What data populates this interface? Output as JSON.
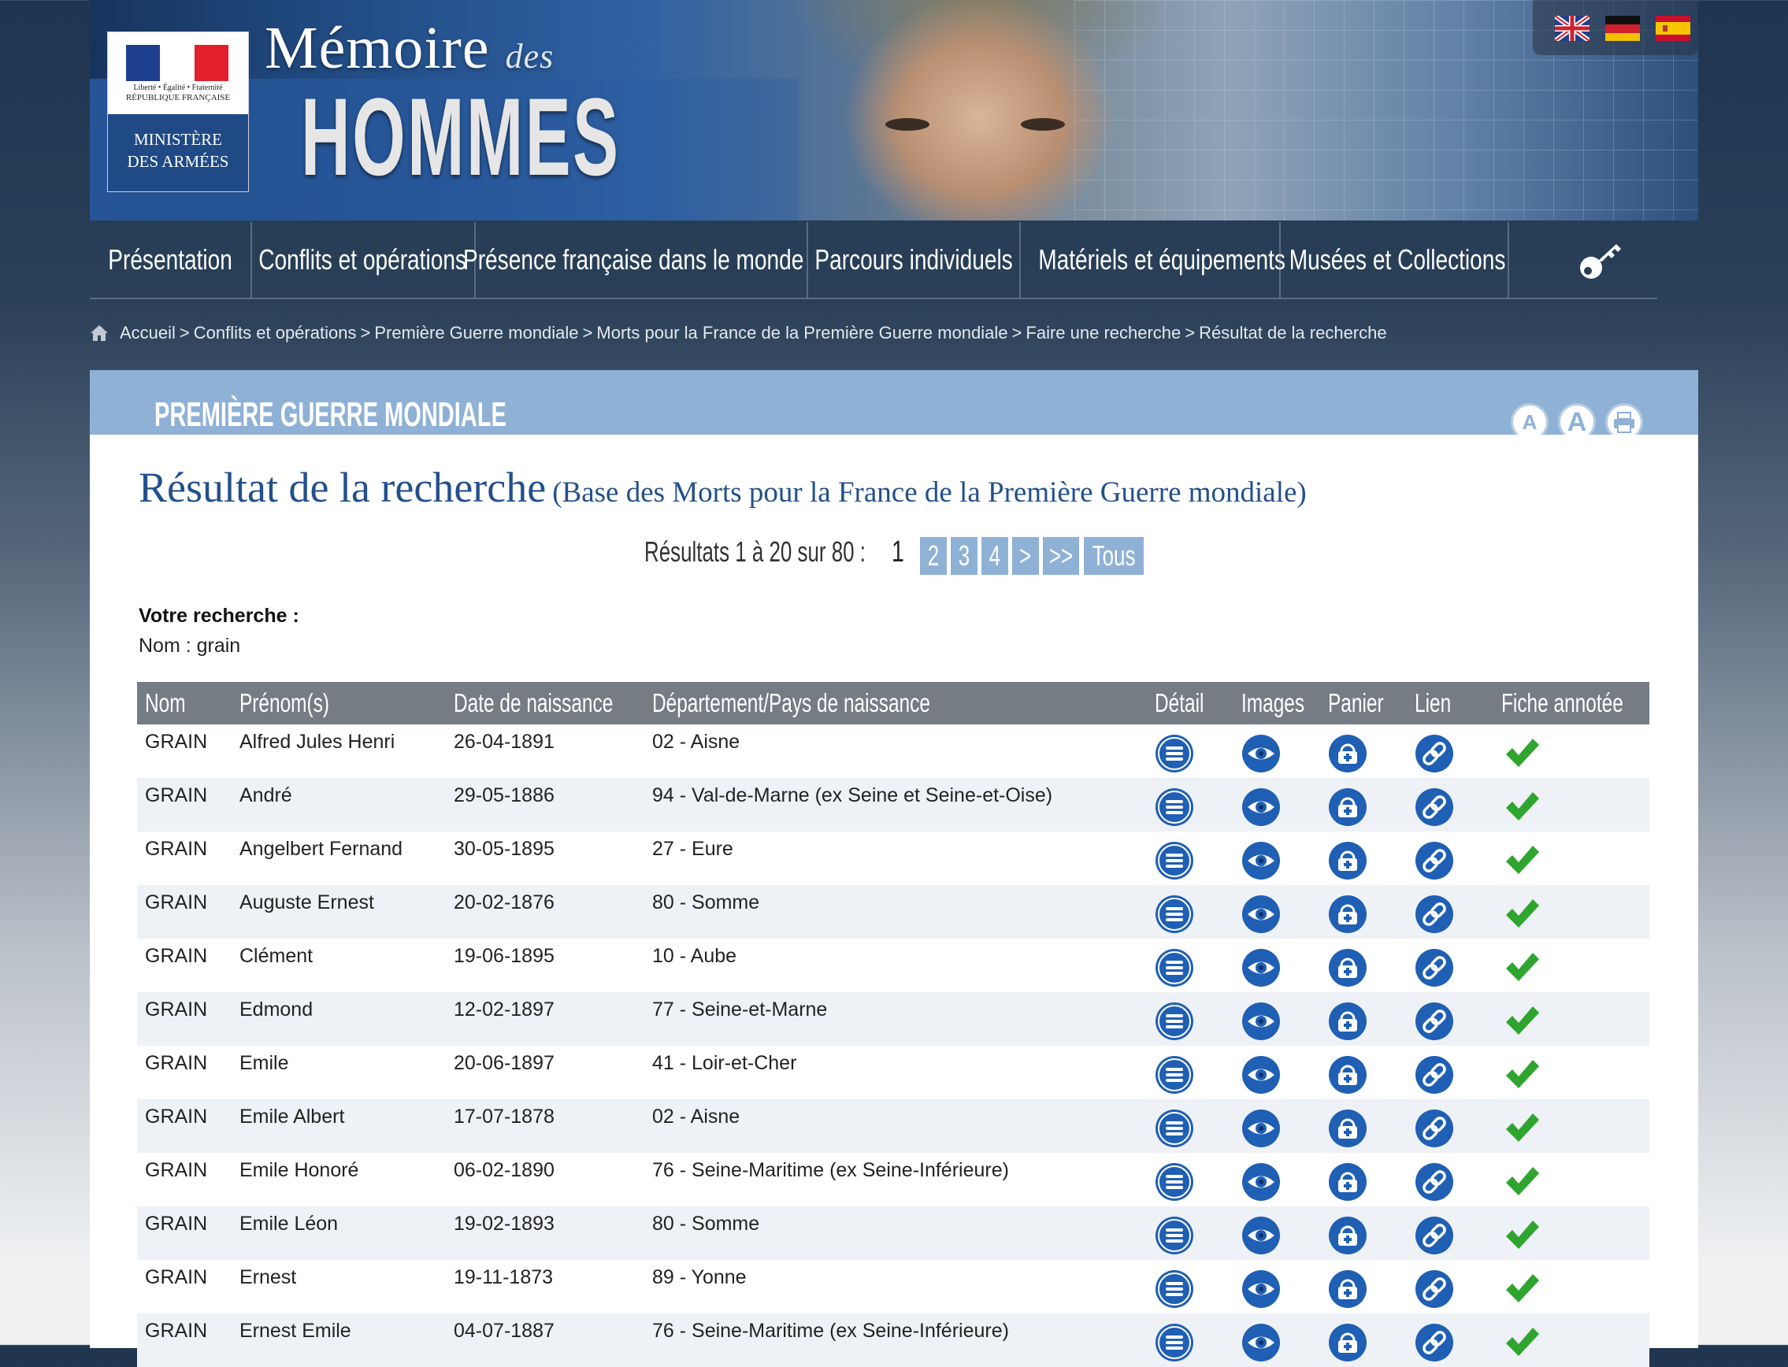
{
  "header": {
    "logo_motto": "Liberté • Égalité • Fraternité",
    "logo_republic": "RÉPUBLIQUE FRANÇAISE",
    "logo_ministry_1": "MINISTÈRE",
    "logo_ministry_2": "DES ARMÉES",
    "site_title_1": "Mémoire",
    "site_title_des": "des",
    "site_title_2": "HOMMES",
    "languages": [
      "uk-flag-icon",
      "de-flag-icon",
      "es-flag-icon"
    ]
  },
  "nav": {
    "items": [
      "Présentation",
      "Conflits et opérations",
      "Présence française dans le monde",
      "Parcours individuels",
      "Matériels et équipements",
      "Musées et Collections"
    ],
    "key_icon": "key-icon"
  },
  "breadcrumb": [
    "Accueil",
    "Conflits et opérations",
    "Première Guerre mondiale",
    "Morts pour la France de la Première Guerre mondiale",
    "Faire une recherche",
    "Résultat de la recherche"
  ],
  "panel": {
    "title": "PREMIÈRE GUERRE MONDIALE",
    "tools": [
      "A",
      "A",
      "print-icon"
    ]
  },
  "result": {
    "heading": "Résultat de la recherche",
    "subheading": "(Base des Morts pour la France de la Première Guerre mondiale)"
  },
  "pager": {
    "label": "Résultats 1 à 20 sur 80 :",
    "current": "1",
    "pages": [
      "2",
      "3",
      "4",
      ">",
      ">>",
      "Tous"
    ]
  },
  "search": {
    "label": "Votre recherche :",
    "criteria": "Nom : grain"
  },
  "table": {
    "headers": [
      "Nom",
      "Prénom(s)",
      "Date de naissance",
      "Département/Pays de naissance",
      "Détail",
      "Images",
      "Panier",
      "Lien",
      "Fiche annotée"
    ],
    "rows": [
      [
        "GRAIN",
        "Alfred Jules Henri",
        "26-04-1891",
        "02 - Aisne"
      ],
      [
        "GRAIN",
        "André",
        "29-05-1886",
        "94 - Val-de-Marne (ex Seine et Seine-et-Oise)"
      ],
      [
        "GRAIN",
        "Angelbert Fernand",
        "30-05-1895",
        "27 - Eure"
      ],
      [
        "GRAIN",
        "Auguste Ernest",
        "20-02-1876",
        "80 - Somme"
      ],
      [
        "GRAIN",
        "Clément",
        "19-06-1895",
        "10 - Aube"
      ],
      [
        "GRAIN",
        "Edmond",
        "12-02-1897",
        "77 - Seine-et-Marne"
      ],
      [
        "GRAIN",
        "Emile",
        "20-06-1897",
        "41 - Loir-et-Cher"
      ],
      [
        "GRAIN",
        "Emile Albert",
        "17-07-1878",
        "02 - Aisne"
      ],
      [
        "GRAIN",
        "Emile Honoré",
        "06-02-1890",
        "76 - Seine-Maritime (ex Seine-Inférieure)"
      ],
      [
        "GRAIN",
        "Emile Léon",
        "19-02-1893",
        "80 - Somme"
      ],
      [
        "GRAIN",
        "Ernest",
        "19-11-1873",
        "89 - Yonne"
      ],
      [
        "GRAIN",
        "Ernest Emile",
        "04-07-1887",
        "76 - Seine-Maritime (ex Seine-Inférieure)"
      ]
    ]
  },
  "colors": {
    "accent_blue": "#23508c",
    "panel_blue": "#8fb1d6",
    "icon_blue": "#1f5fb4",
    "check_green": "#2fa52f",
    "table_header": "#767c84"
  }
}
